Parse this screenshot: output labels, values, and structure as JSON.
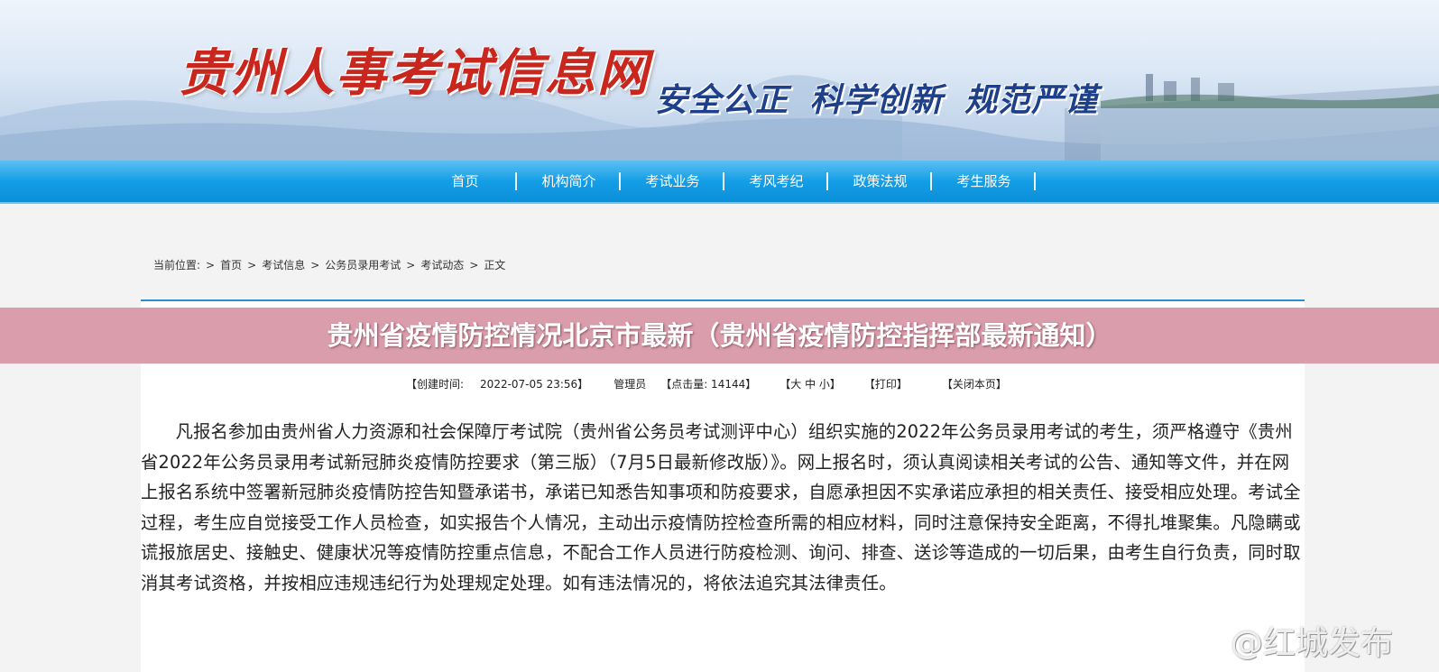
{
  "site": {
    "title": "贵州人事考试信息网",
    "slogan": "安全公正 科学创新 规范严谨"
  },
  "nav": {
    "items": [
      "首页",
      "机构简介",
      "考试业务",
      "考风考纪",
      "政策法规",
      "考生服务"
    ]
  },
  "breadcrumb": {
    "prefix": "当前位置:",
    "items": [
      "首页",
      "考试信息",
      "公务员录用考试",
      "考试动态",
      "正文"
    ],
    "separator": ">"
  },
  "article": {
    "title": "贵州省疫情防控情况北京市最新（贵州省疫情防控指挥部最新通知）",
    "meta": {
      "created_label": "【创建时间:",
      "created_value": "2022-07-05 23:56】",
      "author": "管理员",
      "hits_label": "【点击量: 14144】",
      "font_size": "【大 中 小】",
      "print": "【打印】",
      "close": "【关闭本页】"
    },
    "body": "凡报名参加由贵州省人力资源和社会保障厅考试院（贵州省公务员考试测评中心）组织实施的2022年公务员录用考试的考生，须严格遵守《贵州省2022年公务员录用考试新冠肺炎疫情防控要求（第三版）（7月5日最新修改版）》。网上报名时，须认真阅读相关考试的公告、通知等文件，并在网上报名系统中签署新冠肺炎疫情防控告知暨承诺书，承诺已知悉告知事项和防疫要求，自愿承担因不实承诺应承担的相关责任、接受相应处理。考试全过程，考生应自觉接受工作人员检查，如实报告个人情况，主动出示疫情防控检查所需的相应材料，同时注意保持安全距离，不得扎堆聚集。凡隐瞒或谎报旅居史、接触史、健康状况等疫情防控重点信息，不配合工作人员进行防疫检测、询问、排查、送诊等造成的一切后果，由考生自行负责，同时取消其考试资格，并按相应违规违纪行为处理规定处理。如有违法情况的，将依法追究其法律责任。"
  },
  "watermark": {
    "text": "@红城发布",
    "icon": "weibo-icon"
  },
  "colors": {
    "nav_blue": "#139ee5",
    "title_red": "#c9261e",
    "slogan_blue": "#1e3f8a",
    "title_band": "#d696a6"
  }
}
